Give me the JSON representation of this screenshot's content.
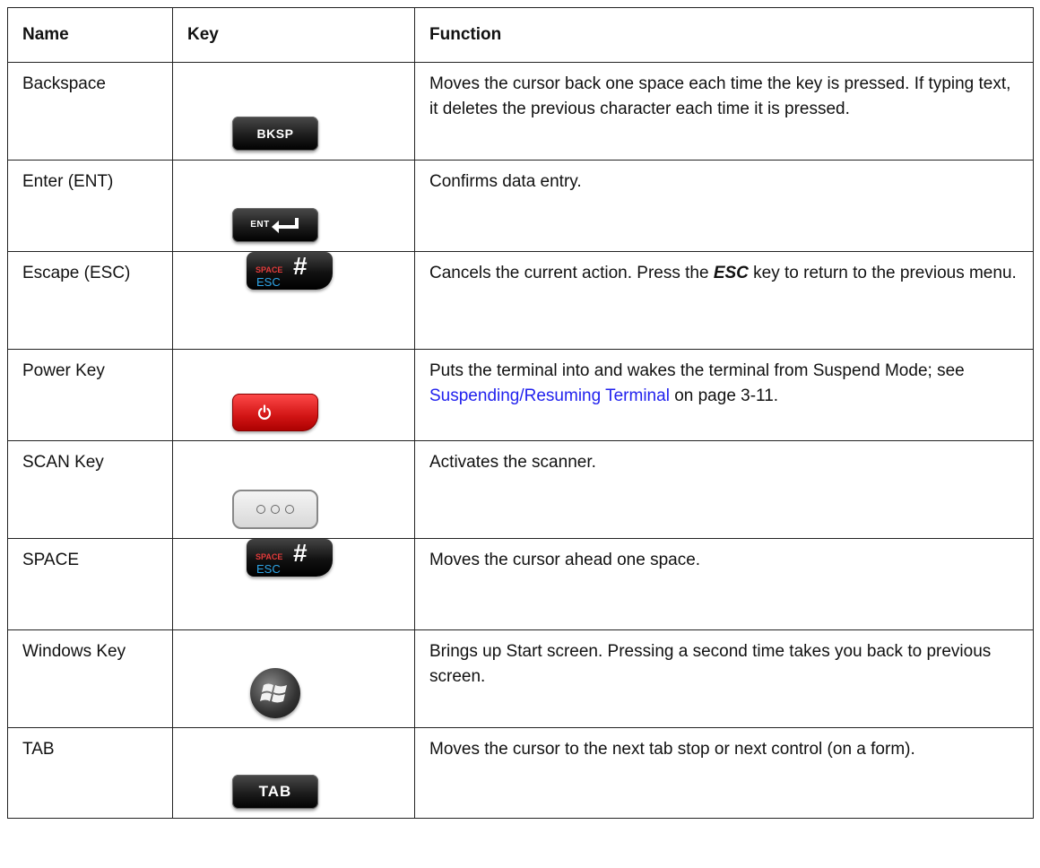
{
  "headers": {
    "name": "Name",
    "key": "Key",
    "function": "Function"
  },
  "rows": [
    {
      "name": "Backspace",
      "key_icon": "bksp-key-icon",
      "key_label": "BKSP",
      "function": "Moves the cursor back one space each time the key is pressed. If typing text, it deletes the previous character each time it is pressed."
    },
    {
      "name": "Enter (ENT)",
      "key_icon": "enter-key-icon",
      "key_label": "ENT",
      "function": "Confirms data entry."
    },
    {
      "name": "Escape (ESC)",
      "key_icon": "space-esc-key-icon",
      "key_label_top": "SPACE",
      "key_label_bottom": "ESC",
      "key_label_main": "#",
      "function_pre": "Cancels the current action. Press the ",
      "function_emph": "ESC",
      "function_post": " key to return to the previous menu."
    },
    {
      "name": "Power Key",
      "key_icon": "power-key-icon",
      "function_pre": "Puts the terminal into and wakes the terminal from Suspend Mode; see ",
      "function_link": "Suspending/Resuming Terminal",
      "function_post": " on page 3-11."
    },
    {
      "name": "SCAN Key",
      "key_icon": "scan-key-icon",
      "function": "Activates the scanner."
    },
    {
      "name": "SPACE",
      "key_icon": "space-esc-key-icon",
      "key_label_top": "SPACE",
      "key_label_bottom": "ESC",
      "key_label_main": "#",
      "function": "Moves the cursor ahead one space."
    },
    {
      "name": "Windows Key",
      "key_icon": "windows-key-icon",
      "function": "Brings up Start screen. Pressing a second time takes you back to previous screen."
    },
    {
      "name": "TAB",
      "key_icon": "tab-key-icon",
      "key_label": "TAB",
      "function": "Moves the cursor to the next tab stop or next control (on a form)."
    }
  ],
  "colors": {
    "link": "#2222ee",
    "power_key": "#d11414",
    "space_label": "#e23b3b",
    "esc_label": "#2fa6e8"
  }
}
